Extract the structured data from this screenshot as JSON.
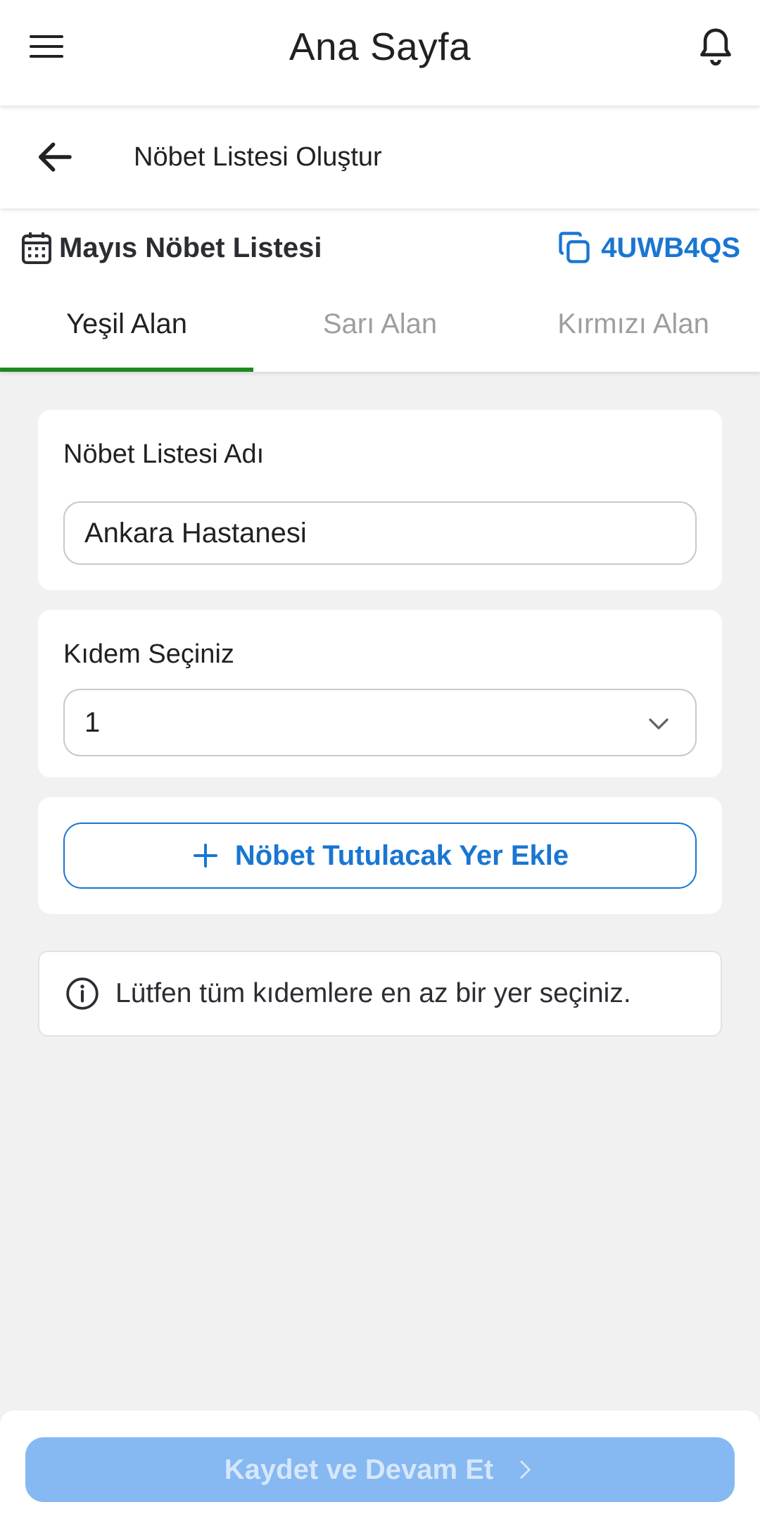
{
  "header": {
    "title": "Ana Sayfa",
    "menu_icon": "menu-icon",
    "bell_icon": "bell-icon"
  },
  "subheader": {
    "title": "Nöbet Listesi Oluştur",
    "back_icon": "arrow-left-icon"
  },
  "list": {
    "name": "Mayıs Nöbet Listesi",
    "code": "4UWB4QS",
    "calendar_icon": "calendar-icon",
    "copy_icon": "copy-icon"
  },
  "tabs": [
    {
      "label": "Yeşil Alan",
      "active": true
    },
    {
      "label": "Sarı Alan",
      "active": false
    },
    {
      "label": "Kırmızı Alan",
      "active": false
    }
  ],
  "form": {
    "list_name_label": "Nöbet Listesi Adı",
    "list_name_value": "Ankara Hastanesi",
    "kidem_label": "Kıdem Seçiniz",
    "kidem_value": "1",
    "add_place_label": "Nöbet Tutulacak Yer Ekle"
  },
  "info": {
    "message": "Lütfen tüm kıdemlere en az bir yer seçiniz."
  },
  "footer": {
    "save_label": "Kaydet ve Devam Et"
  },
  "colors": {
    "accent": "#1976d2",
    "active_tab": "#1e8a1e",
    "disabled_button": "#86b8f2",
    "background": "#f1f1f1"
  }
}
